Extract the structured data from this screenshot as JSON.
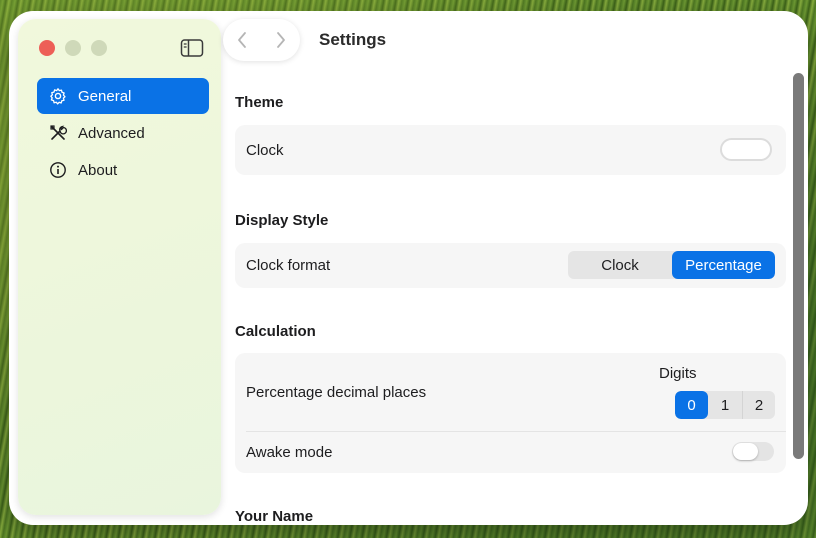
{
  "window": {
    "title": "Settings"
  },
  "sidebar": {
    "items": [
      {
        "label": "General",
        "icon": "gear-icon",
        "active": true
      },
      {
        "label": "Advanced",
        "icon": "tools-icon",
        "active": false
      },
      {
        "label": "About",
        "icon": "info-icon",
        "active": false
      }
    ]
  },
  "sections": {
    "theme": {
      "title": "Theme",
      "clock_label": "Clock",
      "clock_enabled": false
    },
    "display_style": {
      "title": "Display Style",
      "clock_format_label": "Clock format",
      "options": [
        "Clock",
        "Percentage"
      ],
      "selected": "Percentage"
    },
    "calculation": {
      "title": "Calculation",
      "decimal_label": "Percentage decimal places",
      "digits_label": "Digits",
      "digits_options": [
        "0",
        "1",
        "2"
      ],
      "digits_selected": "0",
      "awake_label": "Awake mode",
      "awake_enabled": false
    },
    "your_name": {
      "title": "Your Name"
    }
  },
  "colors": {
    "accent": "#0a72e6",
    "close": "#ed5f57"
  }
}
